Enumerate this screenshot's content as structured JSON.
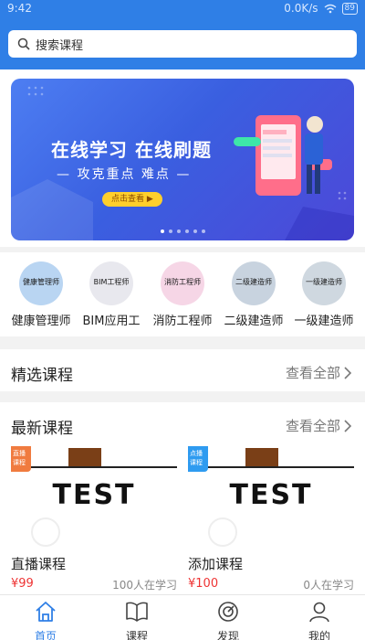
{
  "status_bar": {
    "time": "9:42",
    "speed": "0.0K/s",
    "battery": "89"
  },
  "search": {
    "placeholder": "搜索课程",
    "icon": "search-icon"
  },
  "banner": {
    "title": "在线学习  在线刷题",
    "subtitle": "— 攻克重点 难点 —",
    "button": "点击查看 ▶",
    "dots_total": 6,
    "active_dot": 0
  },
  "categories": [
    {
      "label": "健康管理师",
      "badge": "健康管理师",
      "color": "#b9d5f2"
    },
    {
      "label": "BIM应用工",
      "badge": "BIM工程师",
      "color": "#e8e8ee"
    },
    {
      "label": "消防工程师",
      "badge": "消防工程师",
      "color": "#f6d6e6"
    },
    {
      "label": "二级建造师",
      "badge": "二级建造师",
      "color": "#c8d3df"
    },
    {
      "label": "一级建造师",
      "badge": "一级建造师",
      "color": "#cfd8e0"
    }
  ],
  "featured": {
    "title": "精选课程",
    "more": "查看全部"
  },
  "latest": {
    "title": "最新课程",
    "more": "查看全部",
    "courses": [
      {
        "title": "直播课程",
        "price": "¥99",
        "learners": "100人在学习",
        "thumb_text": "TEST",
        "badge": "直播课程",
        "badge_color": "#f07b3f"
      },
      {
        "title": "添加课程",
        "price": "¥100",
        "learners": "0人在学习",
        "thumb_text": "TEST",
        "badge": "点播课程",
        "badge_color": "#2e9bf0"
      }
    ]
  },
  "nav": [
    {
      "label": "首页",
      "icon": "home-icon",
      "active": true
    },
    {
      "label": "课程",
      "icon": "book-icon",
      "active": false
    },
    {
      "label": "发现",
      "icon": "discover-icon",
      "active": false
    },
    {
      "label": "我的",
      "icon": "user-icon",
      "active": false
    }
  ],
  "colors": {
    "primary": "#2f7fe6",
    "price": "#ee3333"
  }
}
